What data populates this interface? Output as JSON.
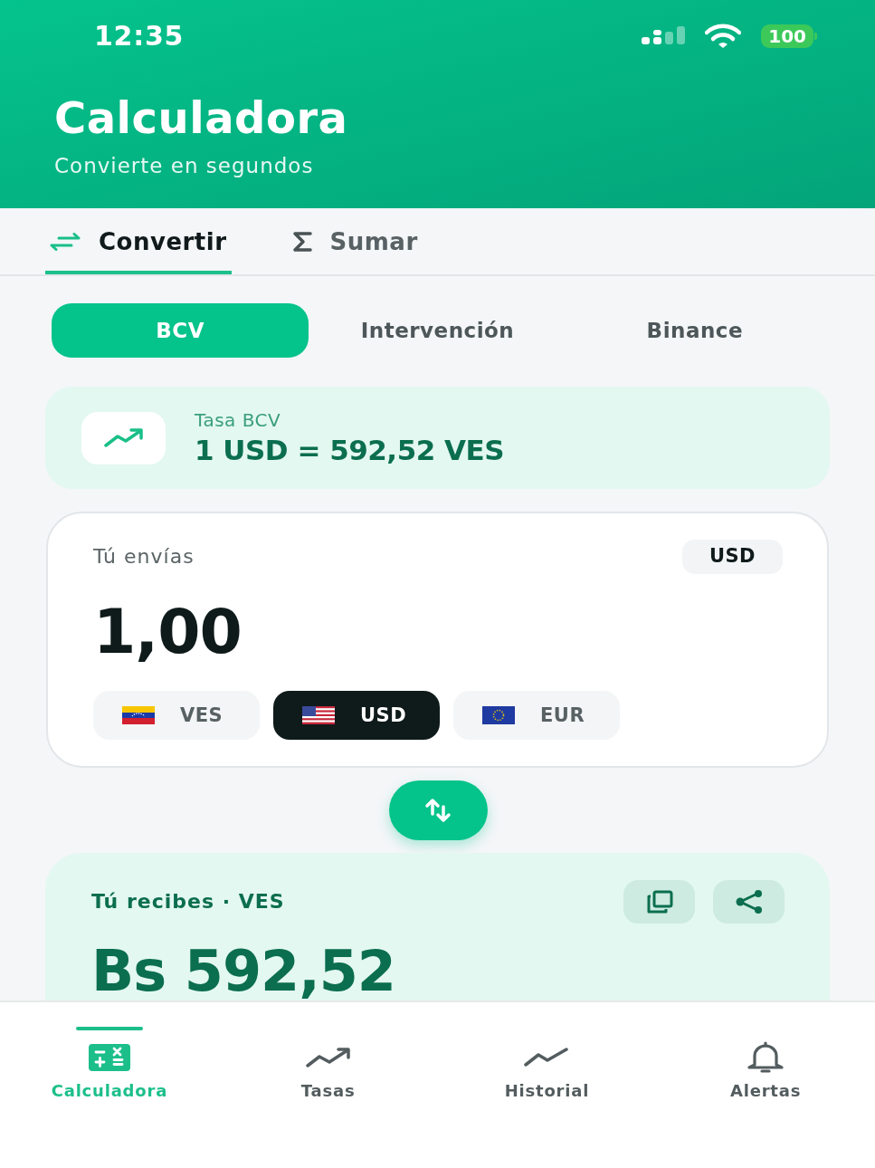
{
  "status_bar": {
    "time": "12:35",
    "battery": "100"
  },
  "header": {
    "title": "Calculadora",
    "subtitle": "Convierte en segundos"
  },
  "mode_tabs": [
    {
      "label": "Convertir",
      "kind": "convert",
      "selected": true
    },
    {
      "label": "Sumar",
      "kind": "sum",
      "selected": false
    }
  ],
  "rate_sources": [
    {
      "label": "BCV",
      "selected": true
    },
    {
      "label": "Intervención",
      "selected": false
    },
    {
      "label": "Binance",
      "selected": false
    }
  ],
  "rate_card": {
    "label": "Tasa BCV",
    "value": "1 USD = 592,52 VES"
  },
  "send_card": {
    "label": "Tú envías",
    "currency_badge": "USD",
    "amount": "1,00",
    "currencies": [
      {
        "code": "VES",
        "kind": "ve",
        "selected": false
      },
      {
        "code": "USD",
        "kind": "us",
        "selected": true
      },
      {
        "code": "EUR",
        "kind": "eu",
        "selected": false
      }
    ]
  },
  "receive_card": {
    "label": "Tú recibes · VES",
    "amount": "Bs 592,52"
  },
  "bottom_nav": [
    {
      "label": "Calculadora",
      "kind": "calculator",
      "selected": true
    },
    {
      "label": "Tasas",
      "kind": "rates",
      "selected": false
    },
    {
      "label": "Historial",
      "kind": "history",
      "selected": false
    },
    {
      "label": "Alertas",
      "kind": "alerts",
      "selected": false
    }
  ]
}
